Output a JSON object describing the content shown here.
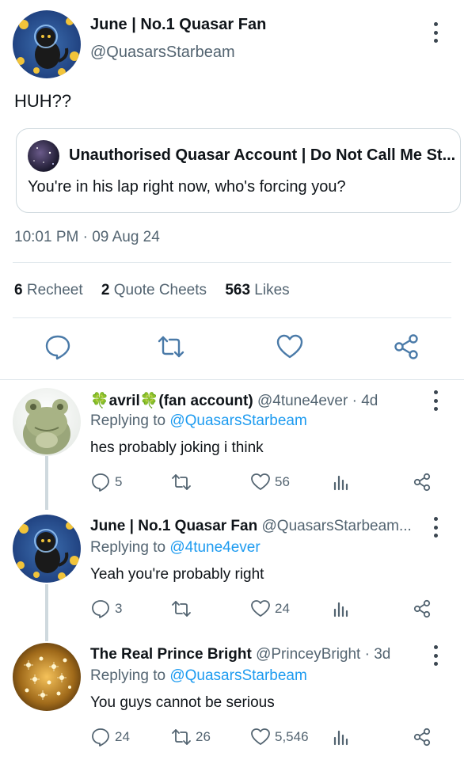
{
  "main_tweet": {
    "author_name": "June | No.1 Quasar Fan",
    "author_handle": "@QuasarsStarbeam",
    "text": "HUH??",
    "quote": {
      "author_name": "Unauthorised Quasar Account | Do Not Call Me St...",
      "text": "You're in his lap right now, who's forcing you?"
    },
    "timestamp": "10:01 PM · 09 Aug 24",
    "stats": {
      "recheet_count": "6",
      "recheet_label": "Recheet",
      "quote_count": "2",
      "quote_label": "Quote Cheets",
      "likes_count": "563",
      "likes_label": "Likes"
    }
  },
  "replies": [
    {
      "name": "🍀avril🍀(fan account)",
      "handle_time": "@4tune4ever · 4d",
      "replying_label": "Replying to",
      "replying_to": "@QuasarsStarbeam",
      "text": "hes probably joking i think",
      "reply_count": "5",
      "recheet_count": "",
      "like_count": "56"
    },
    {
      "name": "June | No.1 Quasar Fan",
      "handle_time": "@QuasarsStarbeam...",
      "replying_label": "Replying to",
      "replying_to": "@4tune4ever",
      "text": "Yeah you're probably right",
      "reply_count": "3",
      "recheet_count": "",
      "like_count": "24"
    },
    {
      "name": "The Real Prince Bright",
      "handle_time": "@PrinceyBright · 3d",
      "replying_label": "Replying to",
      "replying_to": "@QuasarsStarbeam",
      "text": "You guys cannot be serious",
      "reply_count": "24",
      "recheet_count": "26",
      "like_count": "5,546"
    }
  ],
  "colors": {
    "text": "#0f1419",
    "secondary": "#536471",
    "link": "#1d9bf0",
    "icon": "#536471",
    "action_icon": "#4a7aa8",
    "divider": "#e1e8ed"
  },
  "icons": {
    "reply": "speech-bubble",
    "recheet": "retweet-arrows",
    "like": "heart-outline",
    "share": "share-nodes",
    "views": "bar-chart",
    "more": "vertical-ellipsis"
  }
}
